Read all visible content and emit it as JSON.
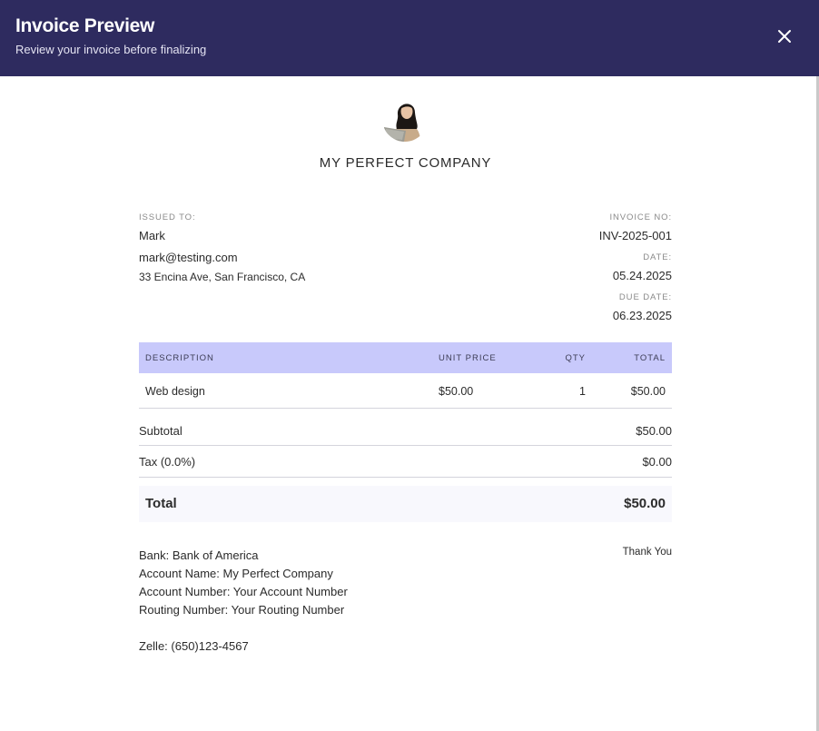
{
  "header": {
    "title": "Invoice Preview",
    "subtitle": "Review your invoice before finalizing",
    "close_icon": "close-icon"
  },
  "company": {
    "name": "MY PERFECT COMPANY",
    "logo_icon": "company-logo-avatar"
  },
  "issued_to": {
    "label": "ISSUED TO:",
    "name": "Mark",
    "email": "mark@testing.com",
    "address": "33 Encina Ave, San Francisco, CA"
  },
  "meta": {
    "invoice_no_label": "INVOICE NO:",
    "invoice_no": "INV-2025-001",
    "date_label": "DATE:",
    "date": "05.24.2025",
    "due_date_label": "DUE DATE:",
    "due_date": "06.23.2025"
  },
  "table": {
    "columns": [
      "DESCRIPTION",
      "UNIT PRICE",
      "QTY",
      "TOTAL"
    ],
    "rows": [
      {
        "description": "Web design",
        "unit_price": "$50.00",
        "qty": "1",
        "total": "$50.00"
      }
    ]
  },
  "summary": {
    "subtotal_label": "Subtotal",
    "subtotal": "$50.00",
    "tax_label": "Tax (0.0%)",
    "tax": "$0.00",
    "total_label": "Total",
    "total": "$50.00"
  },
  "payment": {
    "bank": "Bank: Bank of America",
    "account_name": "Account Name: My Perfect Company",
    "account_number": "Account Number: Your Account Number",
    "routing_number": "Routing Number: Your Routing Number",
    "zelle": "Zelle: (650)123-4567"
  },
  "footer": {
    "thanks": "Thank You"
  },
  "colors": {
    "header_bg": "#2e2b5f",
    "table_header_bg": "#c8c9fb",
    "total_bg": "#f8f8fd"
  }
}
